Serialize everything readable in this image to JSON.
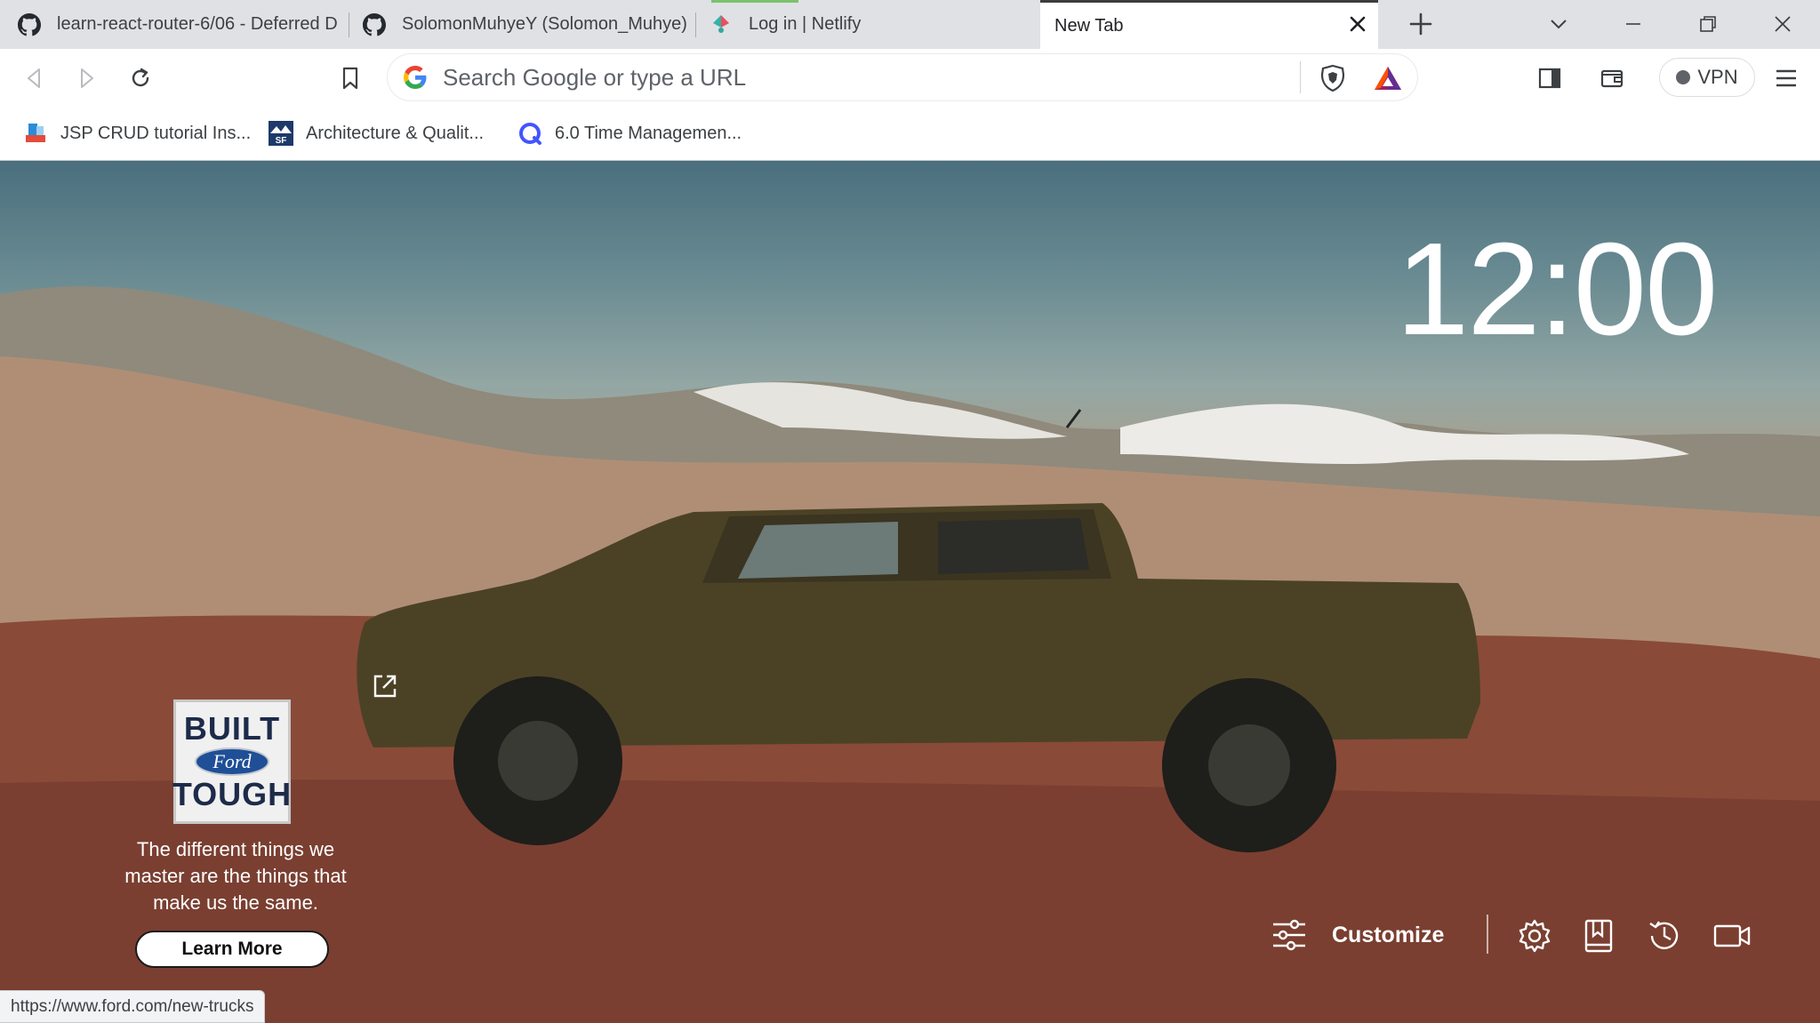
{
  "browser": {
    "tabs": [
      {
        "title": "learn-react-router-6/06 - Deferred D",
        "icon": "github-icon"
      },
      {
        "title": "SolomonMuhyeY (Solomon_Muhye)",
        "icon": "github-icon"
      },
      {
        "title": "Log in | Netlify",
        "icon": "netlify-icon"
      },
      {
        "title": "New Tab",
        "icon": "",
        "active": true
      }
    ],
    "omnibox": {
      "placeholder": "Search Google or type a URL"
    },
    "vpn_label": "VPN",
    "bookmarks": [
      {
        "label": "JSP CRUD tutorial Ins..."
      },
      {
        "label": "Architecture & Qualit..."
      },
      {
        "label": "6.0 Time Managemen..."
      }
    ]
  },
  "ntp": {
    "clock": "12:00",
    "promo": {
      "logo_top": "BUILT",
      "logo_brand": "Ford",
      "logo_bottom": "TOUGH",
      "tagline": "The different things we master are the things that make us the same.",
      "cta": "Learn More"
    },
    "customize_label": "Customize"
  },
  "status_bar": {
    "url": "https://www.ford.com/new-trucks"
  },
  "colors": {
    "accent_brave": "#fb542b",
    "loading": "#7cc26a"
  }
}
